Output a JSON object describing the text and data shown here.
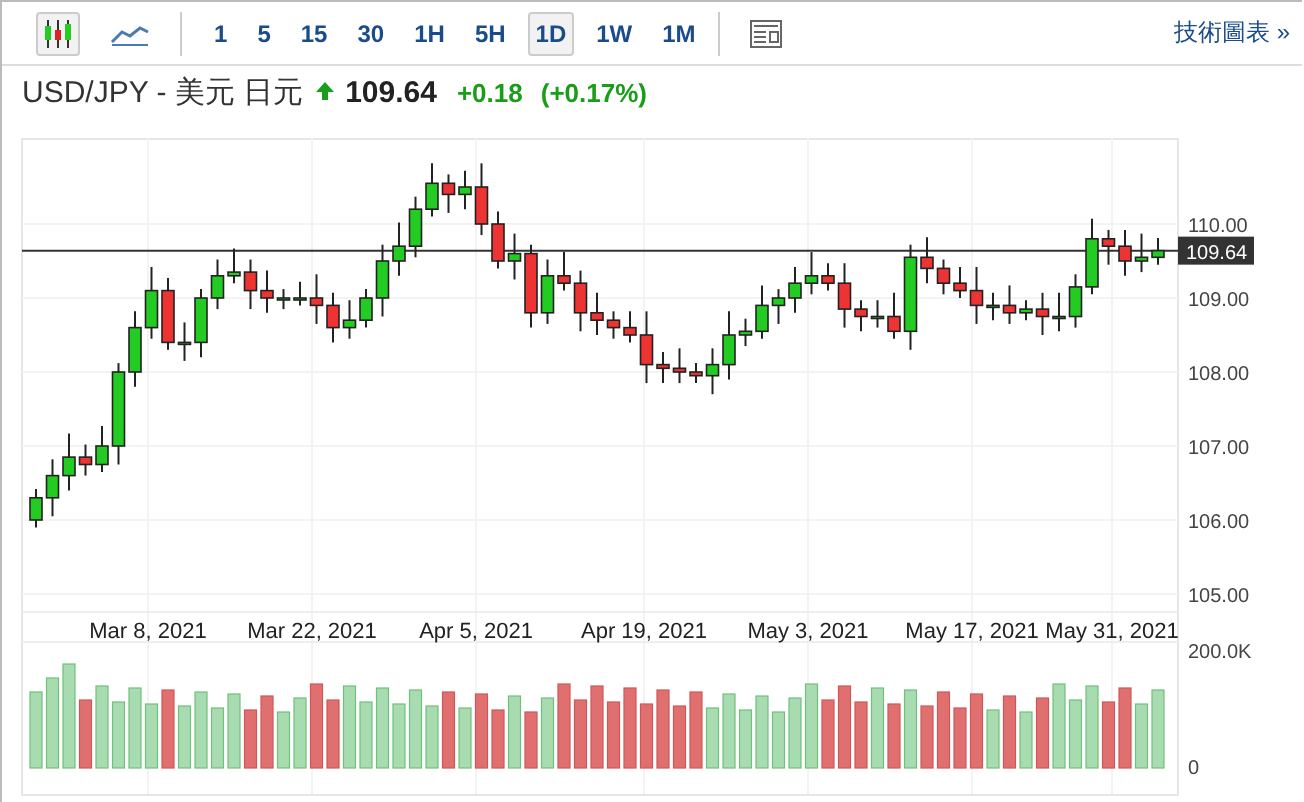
{
  "toolbar": {
    "chart_types": [
      {
        "kind": "candlestick",
        "selected": true
      },
      {
        "kind": "line",
        "selected": false
      }
    ],
    "intervals": [
      {
        "label": "1",
        "selected": false
      },
      {
        "label": "5",
        "selected": false
      },
      {
        "label": "15",
        "selected": false
      },
      {
        "label": "30",
        "selected": false
      },
      {
        "label": "1H",
        "selected": false
      },
      {
        "label": "5H",
        "selected": false
      },
      {
        "label": "1D",
        "selected": true
      },
      {
        "label": "1W",
        "selected": false
      },
      {
        "label": "1M",
        "selected": false
      }
    ],
    "link": "技術圖表 »"
  },
  "quote": {
    "pair": "USD/JPY - 美元 日元",
    "rising": true,
    "price": "109.64",
    "change": "+0.18",
    "change_percent": "(+0.17%)"
  },
  "chart": {
    "y_labels": [
      "110.00",
      "109.00",
      "108.00",
      "107.00",
      "106.00",
      "105.00"
    ],
    "current_price": "109.64",
    "x_labels": [
      "Mar 8, 2021",
      "Mar 22, 2021",
      "Apr 5, 2021",
      "Apr 19, 2021",
      "May 3, 2021",
      "May 17, 2021",
      "May 31, 2021"
    ],
    "volume_labels": [
      "200.0K",
      "0"
    ]
  }
}
